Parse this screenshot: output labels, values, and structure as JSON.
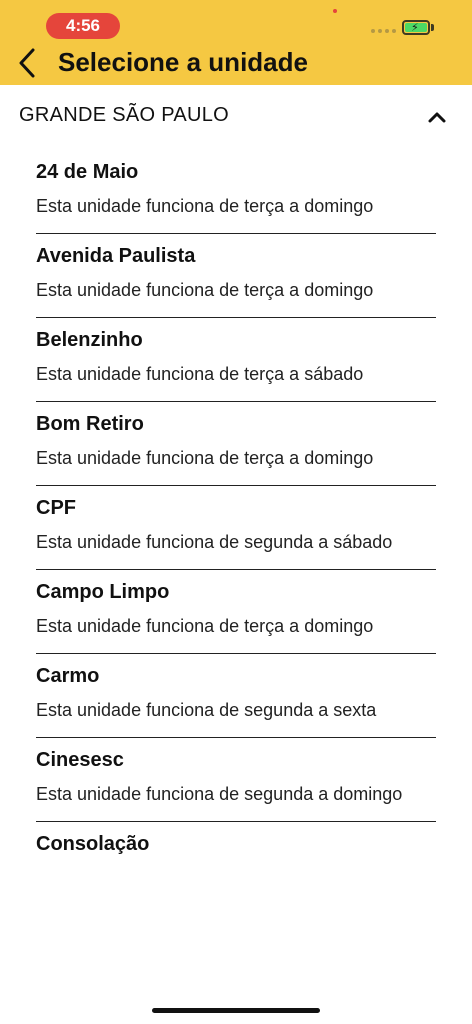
{
  "status_bar": {
    "time": "4:56"
  },
  "header": {
    "title": "Selecione a unidade"
  },
  "section": {
    "title": "GRANDE SÃO PAULO"
  },
  "items": [
    {
      "name": "24 de Maio",
      "desc": "Esta unidade funciona de terça a domingo"
    },
    {
      "name": "Avenida Paulista",
      "desc": "Esta unidade funciona de terça a domingo"
    },
    {
      "name": "Belenzinho",
      "desc": "Esta unidade funciona de terça a sábado"
    },
    {
      "name": "Bom Retiro",
      "desc": "Esta unidade funciona de terça a domingo"
    },
    {
      "name": "CPF",
      "desc": "Esta unidade funciona de segunda a sábado"
    },
    {
      "name": "Campo Limpo",
      "desc": "Esta unidade funciona de terça a domingo"
    },
    {
      "name": "Carmo",
      "desc": "Esta unidade funciona de segunda a sexta"
    },
    {
      "name": "Cinesesc",
      "desc": "Esta unidade funciona de segunda a domingo"
    },
    {
      "name": "Consolação",
      "desc": ""
    }
  ],
  "colors": {
    "header_bg": "#F5C842",
    "time_pill": "#E5453B",
    "battery": "#4CD964"
  },
  "icons": {
    "back": "chevron-left-icon",
    "collapse": "chevron-up-icon",
    "battery": "battery-charging-icon"
  }
}
